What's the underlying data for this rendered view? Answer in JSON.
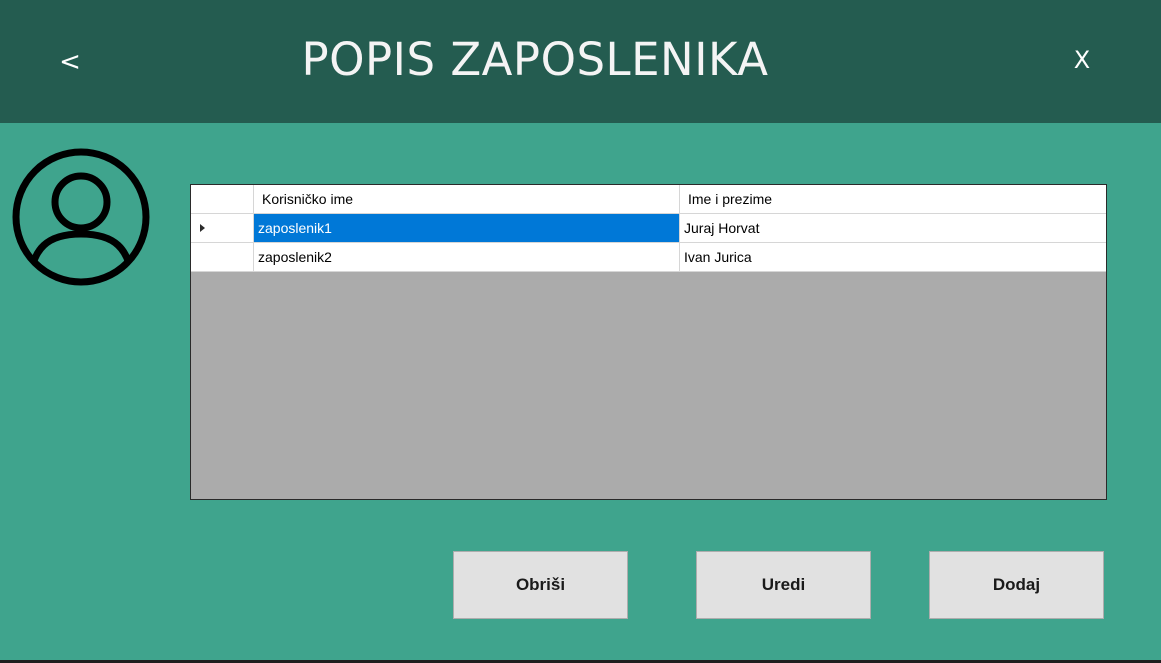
{
  "header": {
    "title": "POPIS ZAPOSLENIKA",
    "back_label": "<",
    "close_label": "X",
    "background_color": "#245c50"
  },
  "window": {
    "background_color": "#3fa48d"
  },
  "avatar": {
    "icon": "user-circle-icon"
  },
  "grid": {
    "columns": [
      "Korisničko ime",
      "Ime i prezime"
    ],
    "rows": [
      {
        "username": "zaposlenik1",
        "full_name": "Juraj Horvat",
        "selected": true
      },
      {
        "username": "zaposlenik2",
        "full_name": "Ivan Jurica",
        "selected": false
      }
    ],
    "selection_color": "#0078d7",
    "empty_area_color": "#ababab"
  },
  "buttons": {
    "delete_label": "Obriši",
    "edit_label": "Uredi",
    "add_label": "Dodaj"
  }
}
